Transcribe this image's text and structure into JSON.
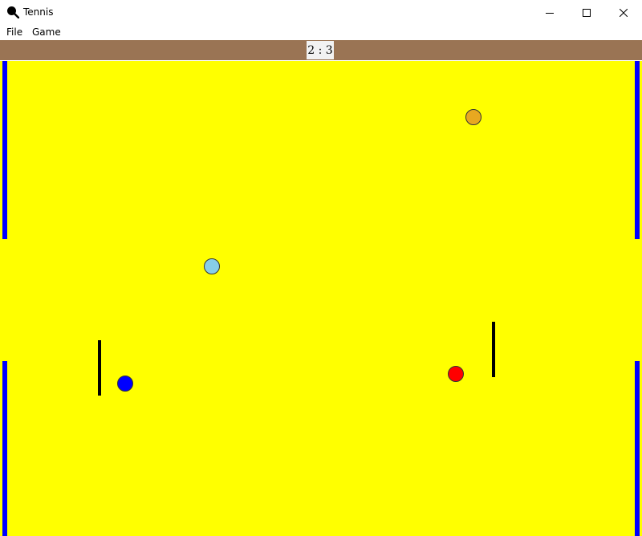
{
  "window": {
    "title": "Tennis"
  },
  "menu": {
    "items": [
      "File",
      "Game"
    ]
  },
  "scoreboard": {
    "score": "2 : 3"
  },
  "colors": {
    "court": "#ffff00",
    "scorebar": "#9a7454",
    "goal": "#0000ff",
    "paddle": "#000000",
    "ball_orange": "#e8a820",
    "ball_light_blue": "#87cee8",
    "ball_blue": "#0000ff",
    "ball_red": "#ff0000"
  },
  "icons": {
    "app": "magnifier-racket-icon",
    "minimize": "minimize-icon",
    "maximize": "maximize-icon",
    "close": "close-icon"
  }
}
